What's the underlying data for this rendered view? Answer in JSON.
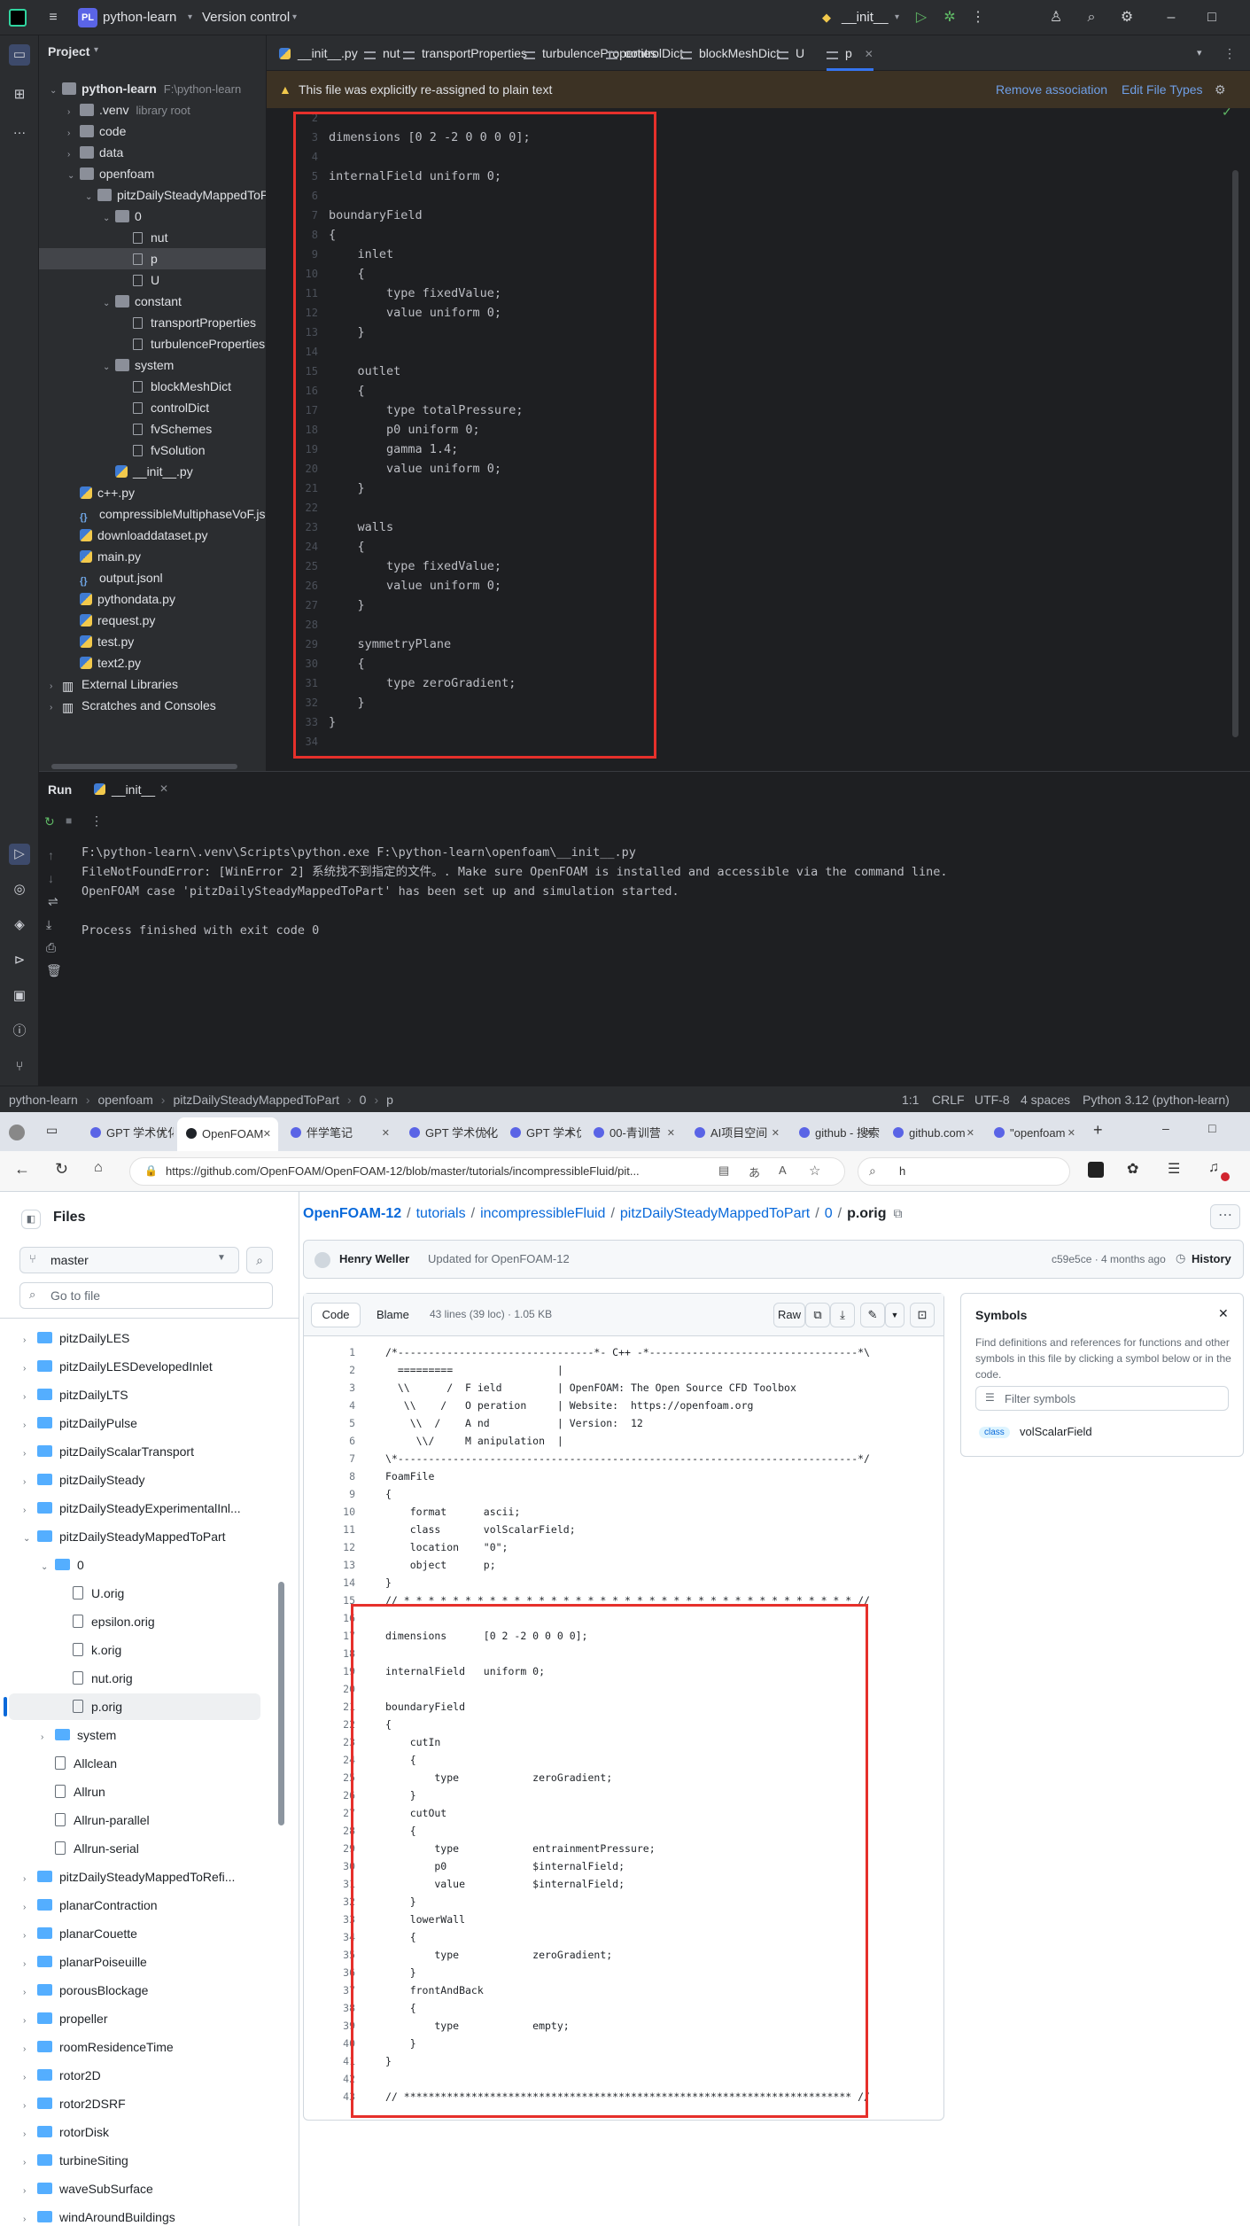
{
  "ide": {
    "project_badge": "PL",
    "project_name": "python-learn",
    "vcs": "Version control",
    "run_config": "__init__",
    "tabs": [
      "__init__.py",
      "nut",
      "transportProperties",
      "turbulenceProperties",
      "controlDict",
      "blockMeshDict",
      "U",
      "p"
    ],
    "banner_text": "This file was explicitly re-assigned to plain text",
    "banner_remove": "Remove association",
    "banner_edit": "Edit File Types",
    "project_label": "Project",
    "tree": [
      {
        "label": "python-learn",
        "suffix": "F:\\python-learn",
        "depth": 0,
        "kind": "root",
        "open": true
      },
      {
        "label": ".venv",
        "suffix": "library root",
        "depth": 1,
        "kind": "folder",
        "open": false
      },
      {
        "label": "code",
        "depth": 1,
        "kind": "folder",
        "open": false
      },
      {
        "label": "data",
        "depth": 1,
        "kind": "folder",
        "open": false
      },
      {
        "label": "openfoam",
        "depth": 1,
        "kind": "folder",
        "open": true
      },
      {
        "label": "pitzDailySteadyMappedToPart",
        "depth": 2,
        "kind": "folder",
        "open": true
      },
      {
        "label": "0",
        "depth": 3,
        "kind": "folder",
        "open": true
      },
      {
        "label": "nut",
        "depth": 4,
        "kind": "file"
      },
      {
        "label": "p",
        "depth": 4,
        "kind": "file",
        "selected": true
      },
      {
        "label": "U",
        "depth": 4,
        "kind": "file"
      },
      {
        "label": "constant",
        "depth": 3,
        "kind": "folder",
        "open": true
      },
      {
        "label": "transportProperties",
        "depth": 4,
        "kind": "file"
      },
      {
        "label": "turbulenceProperties",
        "depth": 4,
        "kind": "file"
      },
      {
        "label": "system",
        "depth": 3,
        "kind": "folder",
        "open": true
      },
      {
        "label": "blockMeshDict",
        "depth": 4,
        "kind": "file"
      },
      {
        "label": "controlDict",
        "depth": 4,
        "kind": "file"
      },
      {
        "label": "fvSchemes",
        "depth": 4,
        "kind": "file"
      },
      {
        "label": "fvSolution",
        "depth": 4,
        "kind": "file"
      },
      {
        "label": "__init__.py",
        "depth": 3,
        "kind": "py"
      },
      {
        "label": "c++.py",
        "depth": 1,
        "kind": "py"
      },
      {
        "label": "compressibleMultiphaseVoF.json",
        "depth": 1,
        "kind": "json"
      },
      {
        "label": "downloaddataset.py",
        "depth": 1,
        "kind": "py"
      },
      {
        "label": "main.py",
        "depth": 1,
        "kind": "py"
      },
      {
        "label": "output.jsonl",
        "depth": 1,
        "kind": "json"
      },
      {
        "label": "pythondata.py",
        "depth": 1,
        "kind": "py"
      },
      {
        "label": "request.py",
        "depth": 1,
        "kind": "py"
      },
      {
        "label": "test.py",
        "depth": 1,
        "kind": "py"
      },
      {
        "label": "text2.py",
        "depth": 1,
        "kind": "py"
      },
      {
        "label": "External Libraries",
        "depth": 0,
        "kind": "lib",
        "open": false
      },
      {
        "label": "Scratches and Consoles",
        "depth": 0,
        "kind": "lib",
        "open": false
      }
    ],
    "code_lines": [
      "",
      "dimensions [0 2 -2 0 0 0 0];",
      "",
      "internalField uniform 0;",
      "",
      "boundaryField",
      "{",
      "    inlet",
      "    {",
      "        type fixedValue;",
      "        value uniform 0;",
      "    }",
      "",
      "    outlet",
      "    {",
      "        type totalPressure;",
      "        p0 uniform 0;",
      "        gamma 1.4;",
      "        value uniform 0;",
      "    }",
      "",
      "    walls",
      "    {",
      "        type fixedValue;",
      "        value uniform 0;",
      "    }",
      "",
      "    symmetryPlane",
      "    {",
      "        type zeroGradient;",
      "    }",
      "}",
      ""
    ],
    "line_start": 2,
    "run_label": "Run",
    "run_tab": "__init__",
    "console": [
      "F:\\python-learn\\.venv\\Scripts\\python.exe F:\\python-learn\\openfoam\\__init__.py",
      "FileNotFoundError: [WinError 2] 系统找不到指定的文件。. Make sure OpenFOAM is installed and accessible via the command line.",
      "OpenFOAM case 'pitzDailySteadyMappedToPart' has been set up and simulation started.",
      "",
      "Process finished with exit code 0"
    ],
    "breadcrumb": [
      "python-learn",
      "openfoam",
      "pitzDailySteadyMappedToPart",
      "0",
      "p"
    ],
    "status": {
      "pos": "1:1",
      "eol": "CRLF",
      "enc": "UTF-8",
      "indent": "4 spaces",
      "interp": "Python 3.12 (python-learn)"
    }
  },
  "browser": {
    "tabs": [
      "GPT 学术优化",
      "OpenFOAM",
      "伴学笔记",
      "GPT 学术优化",
      "GPT 学术优化",
      "00-青训营",
      "AI项目空间",
      "github - 搜索",
      "github.com",
      "\"openfoam"
    ],
    "active_tab": 1,
    "url": "https://github.com/OpenFOAM/OpenFOAM-12/blob/master/tutorials/incompressibleFluid/pit...",
    "search_text": "h",
    "files_title": "Files",
    "branch": "master",
    "goto_placeholder": "Go to file",
    "tree": [
      {
        "label": "pitzDailyLES",
        "depth": 1,
        "kind": "folder"
      },
      {
        "label": "pitzDailyLESDevelopedInlet",
        "depth": 1,
        "kind": "folder"
      },
      {
        "label": "pitzDailyLTS",
        "depth": 1,
        "kind": "folder"
      },
      {
        "label": "pitzDailyPulse",
        "depth": 1,
        "kind": "folder"
      },
      {
        "label": "pitzDailyScalarTransport",
        "depth": 1,
        "kind": "folder"
      },
      {
        "label": "pitzDailySteady",
        "depth": 1,
        "kind": "folder"
      },
      {
        "label": "pitzDailySteadyExperimentalInl...",
        "depth": 1,
        "kind": "folder"
      },
      {
        "label": "pitzDailySteadyMappedToPart",
        "depth": 1,
        "kind": "folder",
        "open": true
      },
      {
        "label": "0",
        "depth": 2,
        "kind": "folder",
        "open": true
      },
      {
        "label": "U.orig",
        "depth": 3,
        "kind": "file"
      },
      {
        "label": "epsilon.orig",
        "depth": 3,
        "kind": "file"
      },
      {
        "label": "k.orig",
        "depth": 3,
        "kind": "file"
      },
      {
        "label": "nut.orig",
        "depth": 3,
        "kind": "file"
      },
      {
        "label": "p.orig",
        "depth": 3,
        "kind": "file",
        "selected": true
      },
      {
        "label": "system",
        "depth": 2,
        "kind": "folder"
      },
      {
        "label": "Allclean",
        "depth": 2,
        "kind": "file"
      },
      {
        "label": "Allrun",
        "depth": 2,
        "kind": "file"
      },
      {
        "label": "Allrun-parallel",
        "depth": 2,
        "kind": "file"
      },
      {
        "label": "Allrun-serial",
        "depth": 2,
        "kind": "file"
      },
      {
        "label": "pitzDailySteadyMappedToRefi...",
        "depth": 1,
        "kind": "folder"
      },
      {
        "label": "planarContraction",
        "depth": 1,
        "kind": "folder"
      },
      {
        "label": "planarCouette",
        "depth": 1,
        "kind": "folder"
      },
      {
        "label": "planarPoiseuille",
        "depth": 1,
        "kind": "folder"
      },
      {
        "label": "porousBlockage",
        "depth": 1,
        "kind": "folder"
      },
      {
        "label": "propeller",
        "depth": 1,
        "kind": "folder"
      },
      {
        "label": "roomResidenceTime",
        "depth": 1,
        "kind": "folder"
      },
      {
        "label": "rotor2D",
        "depth": 1,
        "kind": "folder"
      },
      {
        "label": "rotor2DSRF",
        "depth": 1,
        "kind": "folder"
      },
      {
        "label": "rotorDisk",
        "depth": 1,
        "kind": "folder"
      },
      {
        "label": "turbineSiting",
        "depth": 1,
        "kind": "folder"
      },
      {
        "label": "waveSubSurface",
        "depth": 1,
        "kind": "folder"
      },
      {
        "label": "windAroundBuildings",
        "depth": 1,
        "kind": "folder"
      }
    ],
    "crumbs": [
      "OpenFOAM-12",
      "tutorials",
      "incompressibleFluid",
      "pitzDailySteadyMappedToPart",
      "0"
    ],
    "filename": "p.orig",
    "author": "Henry Weller",
    "commit_msg": "Updated for OpenFOAM-12",
    "commit_meta": "c59e5ce · 4 months ago",
    "history": "History",
    "code_tab": "Code",
    "blame_tab": "Blame",
    "file_info": "43 lines (39 loc) · 1.05 KB",
    "raw": "Raw",
    "symbols_title": "Symbols",
    "symbols_desc": "Find definitions and references for functions and other symbols in this file by clicking a symbol below or in the code.",
    "symbols_filter": "Filter symbols",
    "symbol_kind": "class",
    "symbol_name": "volScalarField",
    "code_lines": [
      "/*--------------------------------*- C++ -*----------------------------------*\\",
      "  =========                 |",
      "  \\\\      /  F ield         | OpenFOAM: The Open Source CFD Toolbox",
      "   \\\\    /   O peration     | Website:  https://openfoam.org",
      "    \\\\  /    A nd           | Version:  12",
      "     \\\\/     M anipulation  |",
      "\\*---------------------------------------------------------------------------*/",
      "FoamFile",
      "{",
      "    format      ascii;",
      "    class       volScalarField;",
      "    location    \"0\";",
      "    object      p;",
      "}",
      "// * * * * * * * * * * * * * * * * * * * * * * * * * * * * * * * * * * * * * //",
      "",
      "dimensions      [0 2 -2 0 0 0 0];",
      "",
      "internalField   uniform 0;",
      "",
      "boundaryField",
      "{",
      "    cutIn",
      "    {",
      "        type            zeroGradient;",
      "    }",
      "    cutOut",
      "    {",
      "        type            entrainmentPressure;",
      "        p0              $internalField;",
      "        value           $internalField;",
      "    }",
      "    lowerWall",
      "    {",
      "        type            zeroGradient;",
      "    }",
      "    frontAndBack",
      "    {",
      "        type            empty;",
      "    }",
      "}",
      "",
      "// ************************************************************************* //"
    ]
  },
  "colors": {
    "accent_red": "#e6302b",
    "gh_link": "#0969da",
    "ide_bg": "#1e1f22"
  }
}
